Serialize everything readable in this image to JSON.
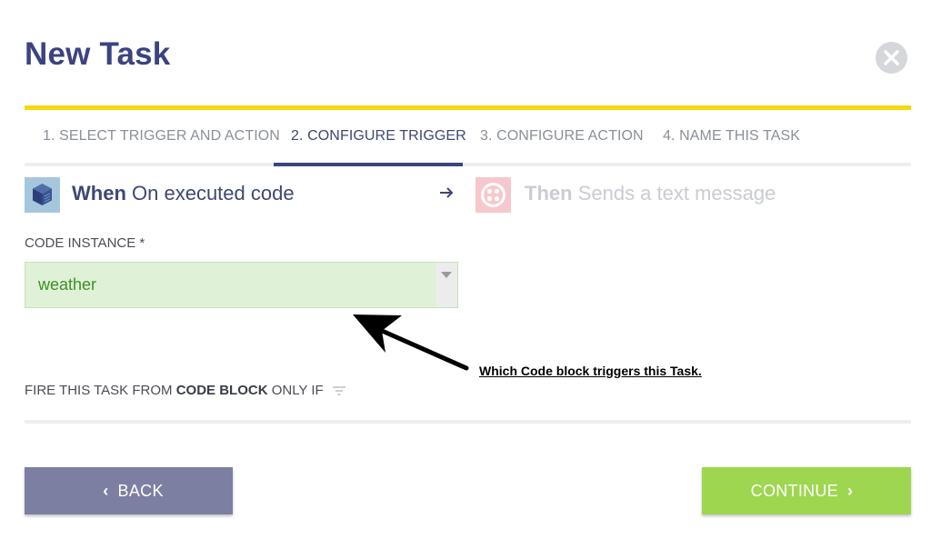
{
  "header": {
    "title": "New Task",
    "close_icon": "close-icon"
  },
  "tabs": [
    {
      "label": "1. SELECT TRIGGER AND ACTION",
      "active": false
    },
    {
      "label": "2. CONFIGURE TRIGGER",
      "active": true
    },
    {
      "label": "3. CONFIGURE ACTION",
      "active": false
    },
    {
      "label": "4. NAME THIS TASK",
      "active": false
    }
  ],
  "steps": {
    "when": {
      "keyword": "When",
      "text": "On executed code",
      "icon": "code-block-cube-icon"
    },
    "then": {
      "keyword": "Then",
      "text": "Sends a text message",
      "icon": "twilio-icon"
    },
    "arrow_icon": "arrow-right-icon"
  },
  "form": {
    "code_instance_label": "CODE INSTANCE *",
    "code_instance_value": "weather",
    "filter_prefix": "FIRE THIS TASK FROM ",
    "filter_bold": "CODE BLOCK",
    "filter_suffix": " ONLY IF",
    "filter_icon": "filter-icon"
  },
  "annotation": {
    "text": "Which Code block triggers this Task."
  },
  "footer": {
    "back_label": "BACK",
    "continue_label": "CONTINUE"
  },
  "colors": {
    "title": "#3b4380",
    "accent_yellow": "#f6d80f",
    "tab_active": "#3b4380",
    "select_bg": "#dff1d6",
    "select_text": "#3f8f27",
    "back_button": "#7d7fa2",
    "continue_button": "#9ed64f"
  }
}
